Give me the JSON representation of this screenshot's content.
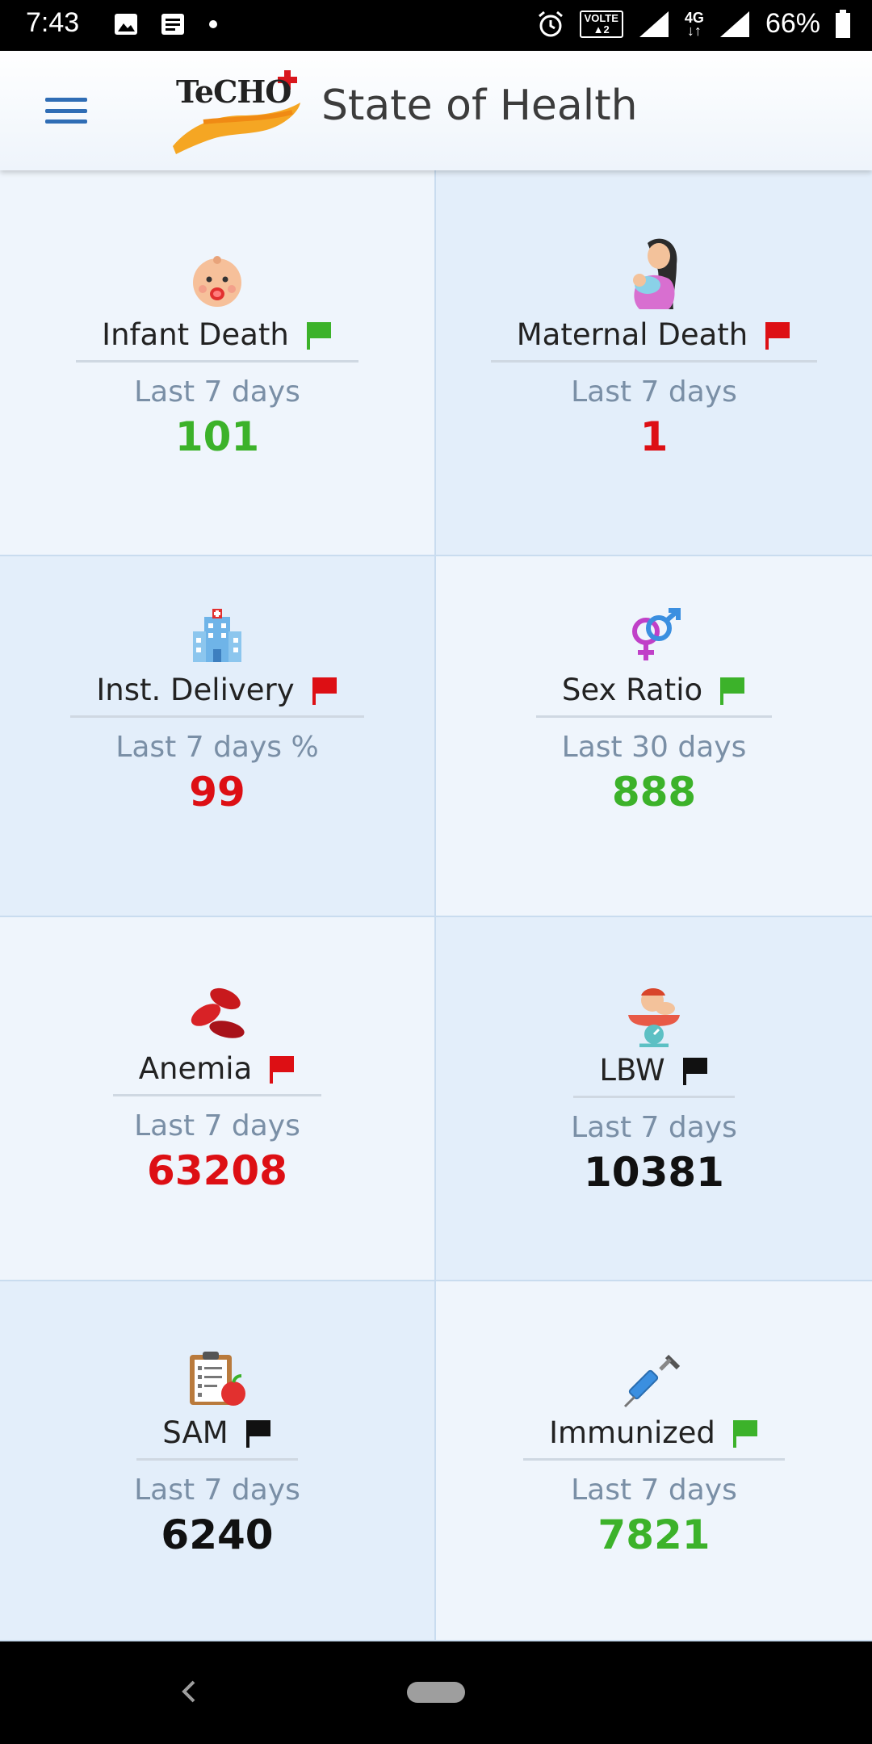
{
  "status_bar": {
    "time": "7:43",
    "volte": "VOLTE",
    "network": "4G",
    "battery": "66%"
  },
  "app_bar": {
    "logo_text": "TeCHO",
    "title": "State of Health"
  },
  "cards": [
    {
      "label": "Infant Death",
      "period": "Last 7 days",
      "value": "101",
      "value_color": "green",
      "flag_color": "#3cb22a",
      "icon": "baby-icon"
    },
    {
      "label": "Maternal Death",
      "period": "Last 7 days",
      "value": "1",
      "value_color": "red",
      "flag_color": "#dd0f14",
      "icon": "mother-icon"
    },
    {
      "label": "Inst. Delivery",
      "period": "Last 7 days %",
      "value": "99",
      "value_color": "red",
      "flag_color": "#dd0f14",
      "icon": "hospital-icon"
    },
    {
      "label": "Sex Ratio",
      "period": "Last 30 days",
      "value": "888",
      "value_color": "green",
      "flag_color": "#3cb22a",
      "icon": "gender-icon"
    },
    {
      "label": "Anemia",
      "period": "Last 7 days",
      "value": "63208",
      "value_color": "red",
      "flag_color": "#dd0f14",
      "icon": "blood-cells-icon"
    },
    {
      "label": "LBW",
      "period": "Last 7 days",
      "value": "10381",
      "value_color": "black",
      "flag_color": "#111111",
      "icon": "baby-scale-icon"
    },
    {
      "label": "SAM",
      "period": "Last 7 days",
      "value": "6240",
      "value_color": "black",
      "flag_color": "#111111",
      "icon": "clipboard-apple-icon"
    },
    {
      "label": "Immunized",
      "period": "Last 7 days",
      "value": "7821",
      "value_color": "green",
      "flag_color": "#3cb22a",
      "icon": "syringe-icon"
    }
  ]
}
